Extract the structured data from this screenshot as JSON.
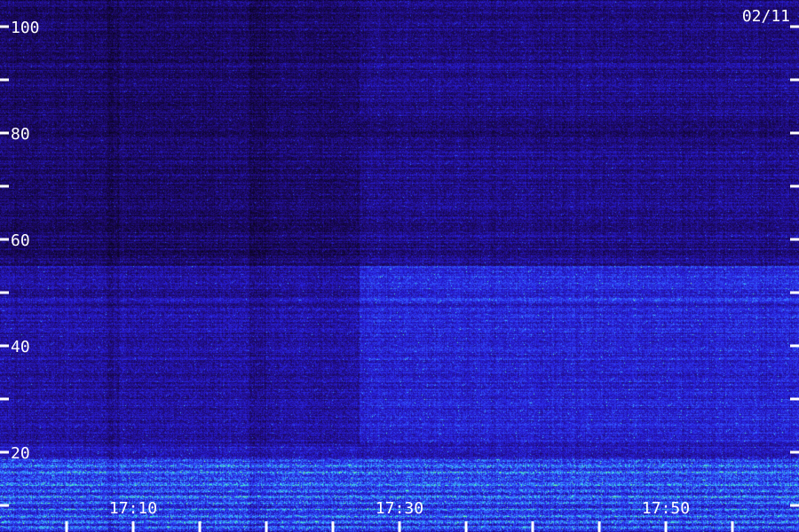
{
  "chart_data": {
    "type": "heatmap",
    "date_label": "02/11",
    "y_ticks": [
      {
        "value": 100,
        "label": "100"
      },
      {
        "value": 90,
        "label": ""
      },
      {
        "value": 80,
        "label": "80"
      },
      {
        "value": 70,
        "label": ""
      },
      {
        "value": 60,
        "label": "60"
      },
      {
        "value": 50,
        "label": ""
      },
      {
        "value": 40,
        "label": "40"
      },
      {
        "value": 30,
        "label": ""
      },
      {
        "value": 20,
        "label": "20"
      },
      {
        "value": 10,
        "label": ""
      }
    ],
    "ylim": [
      5,
      105
    ],
    "x_tick_labels": [
      {
        "minute": 10,
        "label": "17:10"
      },
      {
        "minute": 30,
        "label": "17:30"
      },
      {
        "minute": 50,
        "label": "17:50"
      }
    ],
    "x_minor_ticks": [
      5,
      10,
      15,
      20,
      25,
      30,
      35,
      40,
      45,
      50,
      55
    ],
    "xlim_minutes": [
      0,
      60
    ],
    "colors": {
      "background": "#100830",
      "low": "#1a0a3a",
      "mid": "#2a2aff",
      "high": "#3ad0ff",
      "peak": "#40ff80"
    }
  }
}
